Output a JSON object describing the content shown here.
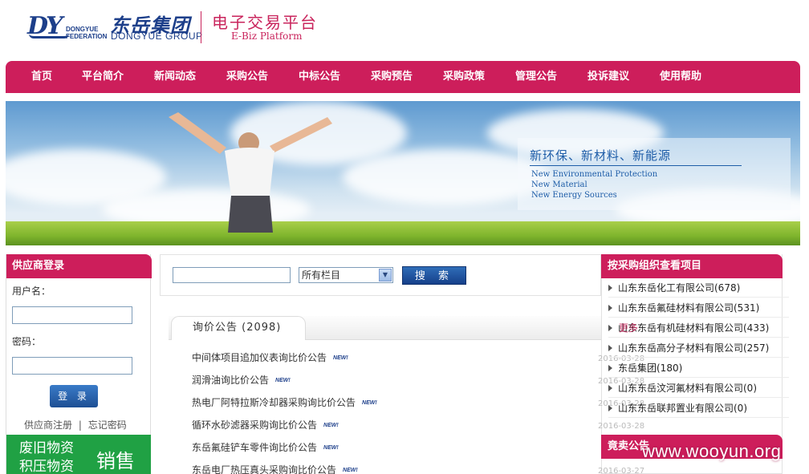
{
  "header": {
    "logo_mark": "DY",
    "logo_federation": [
      "DONGYUE",
      "FEDERATION"
    ],
    "logo_cn": "东岳集团",
    "logo_en": "DONGYUE GROUP",
    "platform_cn": "电子交易平台",
    "platform_en": "E-Biz Platform"
  },
  "nav": {
    "items": [
      "首页",
      "平台简介",
      "新闻动态",
      "采购公告",
      "中标公告",
      "采购预告",
      "采购政策",
      "管理公告",
      "投诉建议",
      "使用帮助"
    ]
  },
  "banner": {
    "slogan": "新环保、新材料、新能源",
    "slogan_en": [
      "New Environmental Protection",
      "New Material",
      "New Energy Sources"
    ]
  },
  "login": {
    "title": "供应商登录",
    "username_label": "用户名：",
    "password_label": "密码：",
    "login_button": "登 录",
    "register_link": "供应商注册",
    "separator": "|",
    "forgot_link": "忘记密码",
    "promo_left": [
      "废旧物资",
      "积压物资"
    ],
    "promo_right": "销售"
  },
  "search": {
    "input_value": "",
    "select_value": "所有栏目",
    "button_label": "搜 索"
  },
  "tabs": {
    "active_label": "询价公告 (2098)"
  },
  "notices": [
    {
      "title": "中间体项目追加仪表询比价公告",
      "badge": "NEW!"
    },
    {
      "title": "润滑油询比价公告",
      "badge": "NEW!"
    },
    {
      "title": "热电厂阿特拉斯冷却器采购询比价公告",
      "badge": "NEW!"
    },
    {
      "title": "循环水砂滤器采购询比价公告",
      "badge": "NEW!"
    },
    {
      "title": "东岳氟硅铲车零件询比价公告",
      "badge": "NEW!"
    },
    {
      "title": "东岳电厂热压真头采购询比价公告",
      "badge": "NEW!"
    }
  ],
  "ghost_dates": [
    "2016-03-28",
    "2016-03-28",
    "2016-03-28",
    "2016-03-28",
    "2016-03-27"
  ],
  "org_panel": {
    "title": "按采购组织查看项目",
    "items": [
      "山东东岳化工有限公司(678)",
      "山东东岳氟硅材料有限公司(531)",
      "山东东岳有机硅材料有限公司(433)",
      "山东东岳高分子材料有限公司(257)",
      "东岳集团(180)",
      "山东东岳汶河氟材料有限公司(0)",
      "山东东岳联邦置业有限公司(0)"
    ],
    "overlap_text": "更多"
  },
  "auction_panel": {
    "title": "竟卖公告"
  },
  "watermark": "www.wooyun.org",
  "colors": {
    "brand_red": "#cd1e5b",
    "brand_blue": "#1d3f8a",
    "promo_green": "#20a144"
  }
}
